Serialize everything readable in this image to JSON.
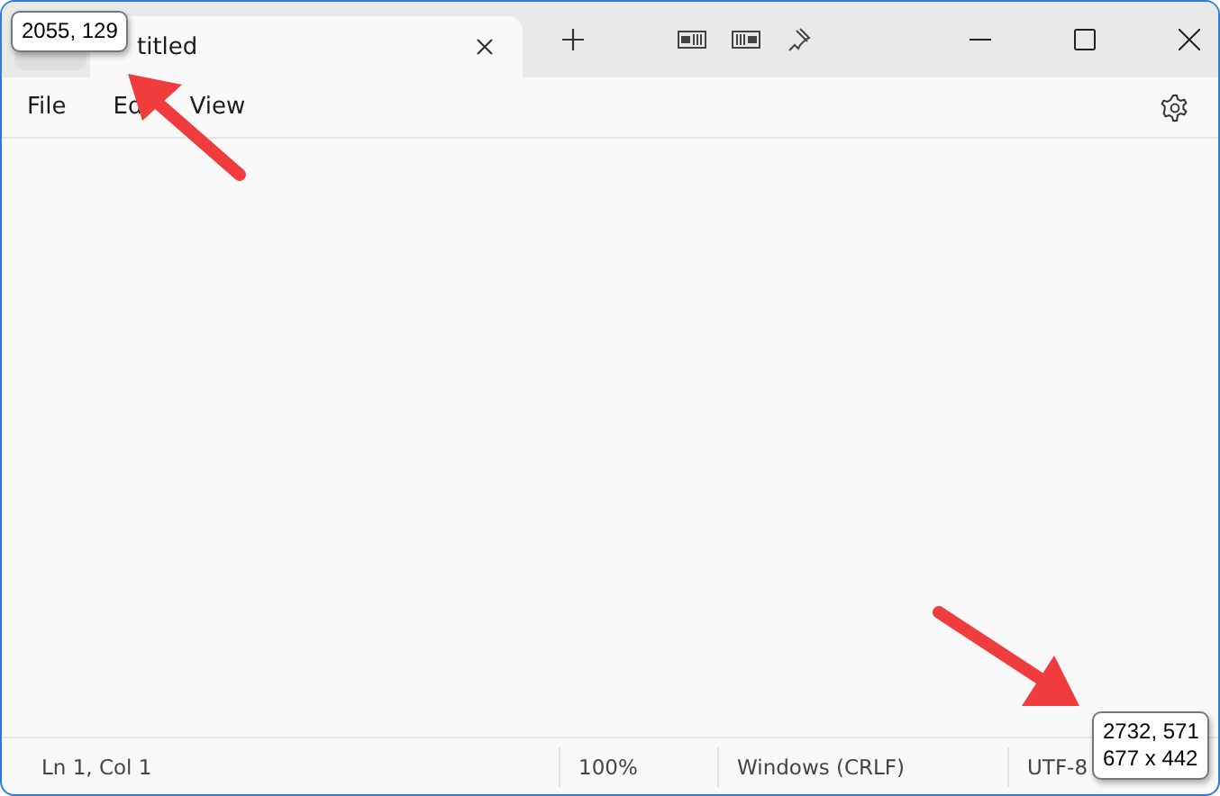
{
  "tab": {
    "title": "titled",
    "selected": true
  },
  "menu": [
    {
      "label": "File"
    },
    {
      "label": "Ed"
    },
    {
      "label": "View"
    }
  ],
  "status_bar": [
    {
      "text": "Ln 1, Col 1"
    },
    {
      "text": "100%"
    },
    {
      "text": "Windows (CRLF)"
    },
    {
      "text": "UTF-8"
    }
  ],
  "tooltips": [
    {
      "lines": [
        "2055, 129"
      ]
    },
    {
      "lines": [
        "2732, 571",
        "677 x 442"
      ]
    }
  ]
}
